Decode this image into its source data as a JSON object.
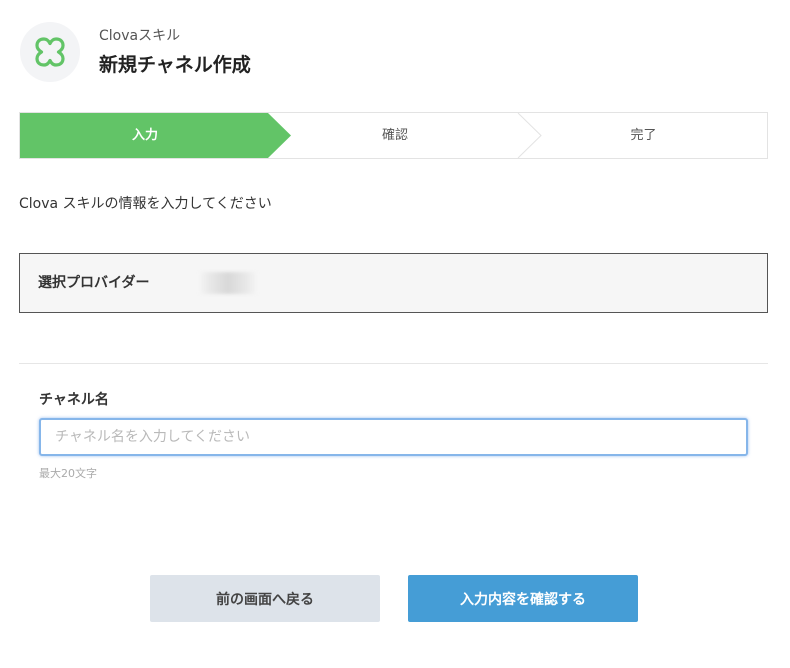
{
  "header": {
    "app_name": "Clovaスキル",
    "title": "新規チャネル作成"
  },
  "steps": [
    {
      "label": "入力",
      "active": true
    },
    {
      "label": "確認",
      "active": false
    },
    {
      "label": "完了",
      "active": false
    }
  ],
  "instruction": "Clova スキルの情報を入力してください",
  "provider": {
    "label": "選択プロバイダー"
  },
  "channel_name": {
    "label": "チャネル名",
    "value": "",
    "placeholder": "チャネル名を入力してください",
    "hint": "最大20文字"
  },
  "buttons": {
    "back": "前の画面へ戻る",
    "confirm": "入力内容を確認する"
  },
  "colors": {
    "active_step": "#62c467",
    "primary_button": "#459dd6",
    "secondary_button": "#dde3ea",
    "logo": "#62c467"
  },
  "icons": {
    "logo": "clova-clover-icon"
  }
}
